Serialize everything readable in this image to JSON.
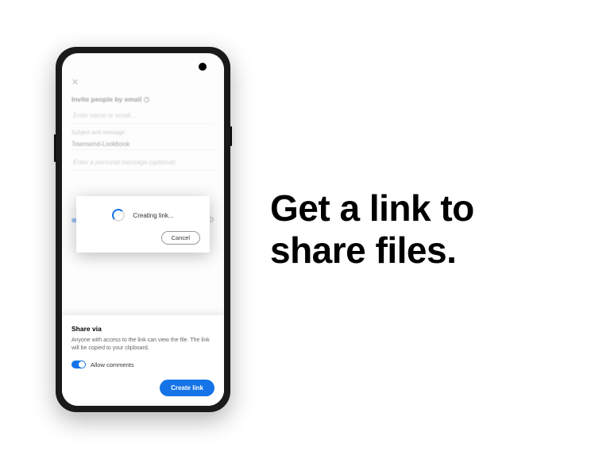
{
  "headline": "Get a link to share files.",
  "screen": {
    "close": "✕",
    "inviteLabel": "Invite people by email",
    "emailPlaceholder": "Enter name or email...",
    "subjectLabel": "Subject and message",
    "subjectValue": "Townsend-Lookbook",
    "messagePlaceholder": "Enter a personal message (optional)"
  },
  "modal": {
    "text": "Creating link...",
    "cancel": "Cancel"
  },
  "sheet": {
    "title": "Share via",
    "description": "Anyone with access to the link can view the file. The link will be copied to your clipboard.",
    "toggleLabel": "Allow comments",
    "button": "Create link"
  }
}
